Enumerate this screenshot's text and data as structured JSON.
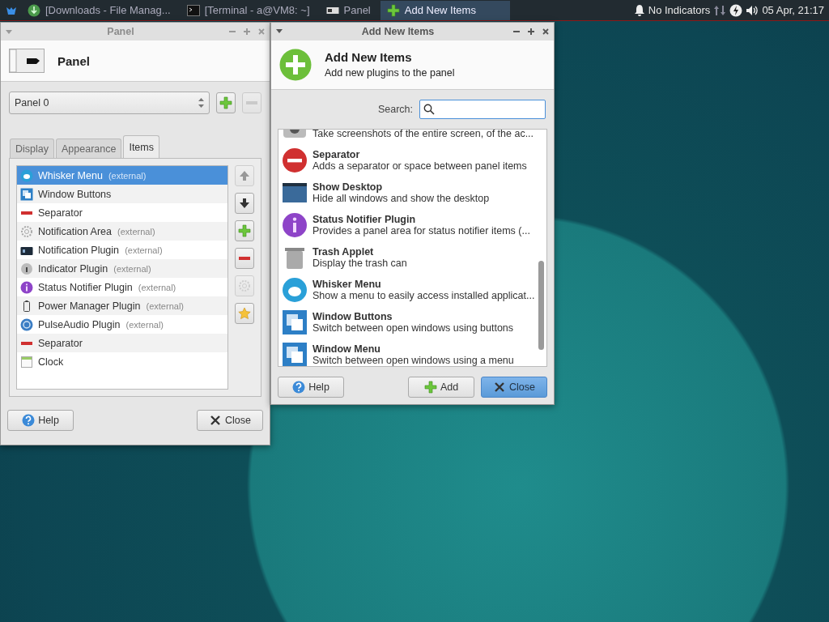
{
  "taskbar": {
    "tasks": [
      {
        "label": "[Downloads - File Manag...",
        "kind": "files",
        "selected": false
      },
      {
        "label": "[Terminal - a@VM8: ~]",
        "kind": "terminal",
        "selected": false
      },
      {
        "label": "Panel",
        "kind": "panel",
        "selected": false
      },
      {
        "label": "Add New Items",
        "kind": "add",
        "selected": true
      }
    ],
    "indicators": "No Indicators",
    "clock": "05 Apr, 21:17"
  },
  "panel_window": {
    "title": "Panel",
    "active": false,
    "header": "Panel",
    "panel_select": "Panel 0",
    "tabs": [
      {
        "label": "Display",
        "selected": false
      },
      {
        "label": "Appearance",
        "selected": false
      },
      {
        "label": "Items",
        "selected": true
      }
    ],
    "items": [
      {
        "name": "Whisker Menu",
        "note": "(external)",
        "kind": "whisker",
        "selected": true
      },
      {
        "name": "Window Buttons",
        "kind": "windows",
        "selected": false
      },
      {
        "name": "Separator",
        "kind": "separator",
        "selected": false
      },
      {
        "name": "Notification Area",
        "note": "(external)",
        "kind": "gear",
        "selected": false
      },
      {
        "name": "Notification Plugin",
        "note": "(external)",
        "kind": "notify",
        "selected": false
      },
      {
        "name": "Indicator Plugin",
        "note": "(external)",
        "kind": "indicator",
        "selected": false
      },
      {
        "name": "Status Notifier Plugin",
        "note": "(external)",
        "kind": "info",
        "selected": false
      },
      {
        "name": "Power Manager Plugin",
        "note": "(external)",
        "kind": "battery",
        "selected": false
      },
      {
        "name": "PulseAudio Plugin",
        "note": "(external)",
        "kind": "audio",
        "selected": false
      },
      {
        "name": "Separator",
        "kind": "separator",
        "selected": false
      },
      {
        "name": "Clock",
        "kind": "clock",
        "selected": false
      }
    ],
    "side_buttons": [
      {
        "kind": "up",
        "disabled": true
      },
      {
        "kind": "down",
        "disabled": false
      },
      {
        "kind": "add",
        "disabled": false
      },
      {
        "kind": "remove",
        "disabled": false
      },
      {
        "kind": "gear",
        "disabled": true
      },
      {
        "kind": "star",
        "disabled": false
      }
    ],
    "buttons": [
      {
        "label": "Help",
        "kind": "help"
      },
      {
        "label": "Close",
        "kind": "close"
      }
    ]
  },
  "add_window": {
    "title": "Add New Items",
    "active": true,
    "header": "Add New Items",
    "subtitle": "Add new plugins to the panel",
    "search_label": "Search:",
    "plugins": [
      {
        "description": "Take screenshots of the entire screen, of the ac...",
        "kind": "camera"
      },
      {
        "name": "Separator",
        "description": "Adds a separator or space between panel items",
        "kind": "separator"
      },
      {
        "name": "Show Desktop",
        "description": "Hide all windows and show the desktop",
        "kind": "desktop"
      },
      {
        "name": "Status Notifier Plugin",
        "description": "Provides a panel area for status notifier items (...",
        "kind": "info"
      },
      {
        "name": "Trash Applet",
        "description": "Display the trash can",
        "kind": "trash"
      },
      {
        "name": "Whisker Menu",
        "description": "Show a menu to easily access installed applicat...",
        "kind": "whisker"
      },
      {
        "name": "Window Buttons",
        "description": "Switch between open windows using buttons",
        "kind": "windows"
      },
      {
        "name": "Window Menu",
        "description": "Switch between open windows using a menu",
        "kind": "windows"
      }
    ],
    "buttons": [
      {
        "label": "Help",
        "kind": "help",
        "default": false
      },
      {
        "label": "Add",
        "kind": "add",
        "default": false
      },
      {
        "label": "Close",
        "kind": "close",
        "default": true
      }
    ]
  }
}
